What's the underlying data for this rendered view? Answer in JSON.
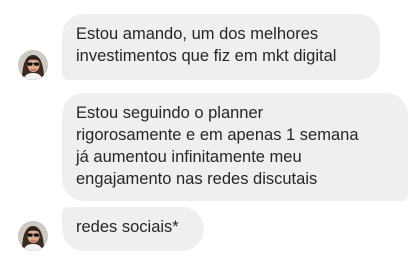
{
  "messages": [
    {
      "lines": [
        "Estou amando, um dos melhores",
        "investimentos que fiz em mkt digital"
      ]
    },
    {
      "lines": [
        "Estou seguindo o planner",
        "rigorosamente e em apenas 1 semana",
        "já aumentou infinitamente meu",
        "engajamento nas redes discutais"
      ]
    },
    {
      "lines": [
        "redes sociais*"
      ]
    }
  ],
  "colors": {
    "bubble": "#efefef",
    "text": "#262626",
    "background": "#ffffff"
  },
  "icons": {
    "avatar": "user-avatar-photo"
  }
}
